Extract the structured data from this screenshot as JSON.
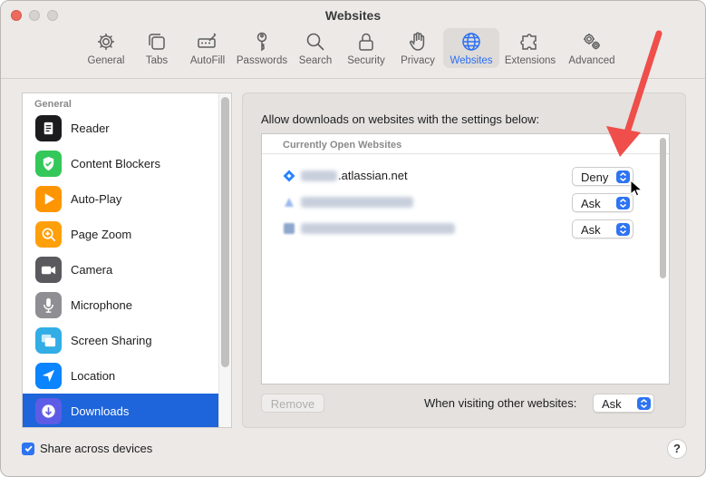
{
  "window": {
    "title": "Websites"
  },
  "toolbar": {
    "items": [
      {
        "label": "General",
        "icon": "gear-icon"
      },
      {
        "label": "Tabs",
        "icon": "tabs-icon"
      },
      {
        "label": "AutoFill",
        "icon": "autofill-icon"
      },
      {
        "label": "Passwords",
        "icon": "key-icon"
      },
      {
        "label": "Search",
        "icon": "search-icon"
      },
      {
        "label": "Security",
        "icon": "lock-icon"
      },
      {
        "label": "Privacy",
        "icon": "hand-icon"
      },
      {
        "label": "Websites",
        "icon": "globe-icon",
        "active": true
      },
      {
        "label": "Extensions",
        "icon": "puzzle-icon"
      },
      {
        "label": "Advanced",
        "icon": "gears-icon"
      }
    ]
  },
  "sidebar": {
    "header": "General",
    "items": [
      {
        "label": "Reader",
        "icon": "reader-icon",
        "color": "#1c1c1e"
      },
      {
        "label": "Content Blockers",
        "icon": "shield-check-icon",
        "color": "#34c759"
      },
      {
        "label": "Auto-Play",
        "icon": "play-icon",
        "color": "#ff9500"
      },
      {
        "label": "Page Zoom",
        "icon": "zoom-icon",
        "color": "#ff9f0a"
      },
      {
        "label": "Camera",
        "icon": "camera-icon",
        "color": "#5a5a5e"
      },
      {
        "label": "Microphone",
        "icon": "microphone-icon",
        "color": "#8e8e93"
      },
      {
        "label": "Screen Sharing",
        "icon": "screen-sharing-icon",
        "color": "#32ade6"
      },
      {
        "label": "Location",
        "icon": "location-icon",
        "color": "#0a84ff"
      },
      {
        "label": "Downloads",
        "icon": "download-icon",
        "color": "#5e5ce6",
        "selected": true
      }
    ]
  },
  "panel": {
    "description": "Allow downloads on websites with the settings below:",
    "list_header": "Currently Open Websites",
    "sites": [
      {
        "domain_visible": ".atlassian.net",
        "setting": "Deny",
        "favicon": "atlassian-icon"
      },
      {
        "domain_visible": "",
        "setting": "Ask",
        "favicon": "atlassian-community-icon"
      },
      {
        "domain_visible": "",
        "setting": "Ask",
        "favicon": "aha-icon"
      }
    ],
    "remove_label": "Remove",
    "other_label": "When visiting other websites:",
    "other_value": "Ask"
  },
  "footer": {
    "share_label": "Share across devices",
    "share_checked": true,
    "help_label": "?"
  },
  "colors": {
    "accent": "#2e74f2",
    "selection": "#1e64db",
    "annotation_arrow": "#ef4e4a"
  }
}
